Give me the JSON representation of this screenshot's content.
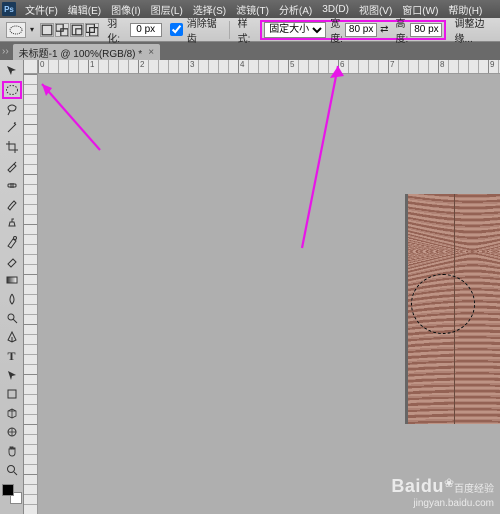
{
  "menu": {
    "ps": "Ps",
    "items": [
      "文件(F)",
      "编辑(E)",
      "图像(I)",
      "图层(L)",
      "选择(S)",
      "滤镜(T)",
      "分析(A)",
      "3D(D)",
      "视图(V)",
      "窗口(W)",
      "帮助(H)"
    ]
  },
  "options": {
    "feather_label": "羽化:",
    "feather_val": "0 px",
    "antialias_label": "消除锯齿",
    "style_label": "样式:",
    "style_val": "固定大小",
    "width_label": "宽度:",
    "width_val": "80 px",
    "swap": "⇄",
    "height_label": "高度:",
    "height_val": "80 px",
    "refine_label": "调整边缘..."
  },
  "tab": {
    "title": "未标题-1 @ 100%(RGB/8) *",
    "close": "×"
  },
  "ruler": {
    "marks": [
      "0",
      "1",
      "2",
      "3",
      "4",
      "5",
      "6",
      "7",
      "8",
      "9"
    ]
  },
  "watermark": {
    "brand": "Baidu",
    "sub": "百度经验",
    "paw": "❀",
    "url": "jingyan.baidu.com"
  },
  "colors": {
    "accent": "#e815e8"
  }
}
